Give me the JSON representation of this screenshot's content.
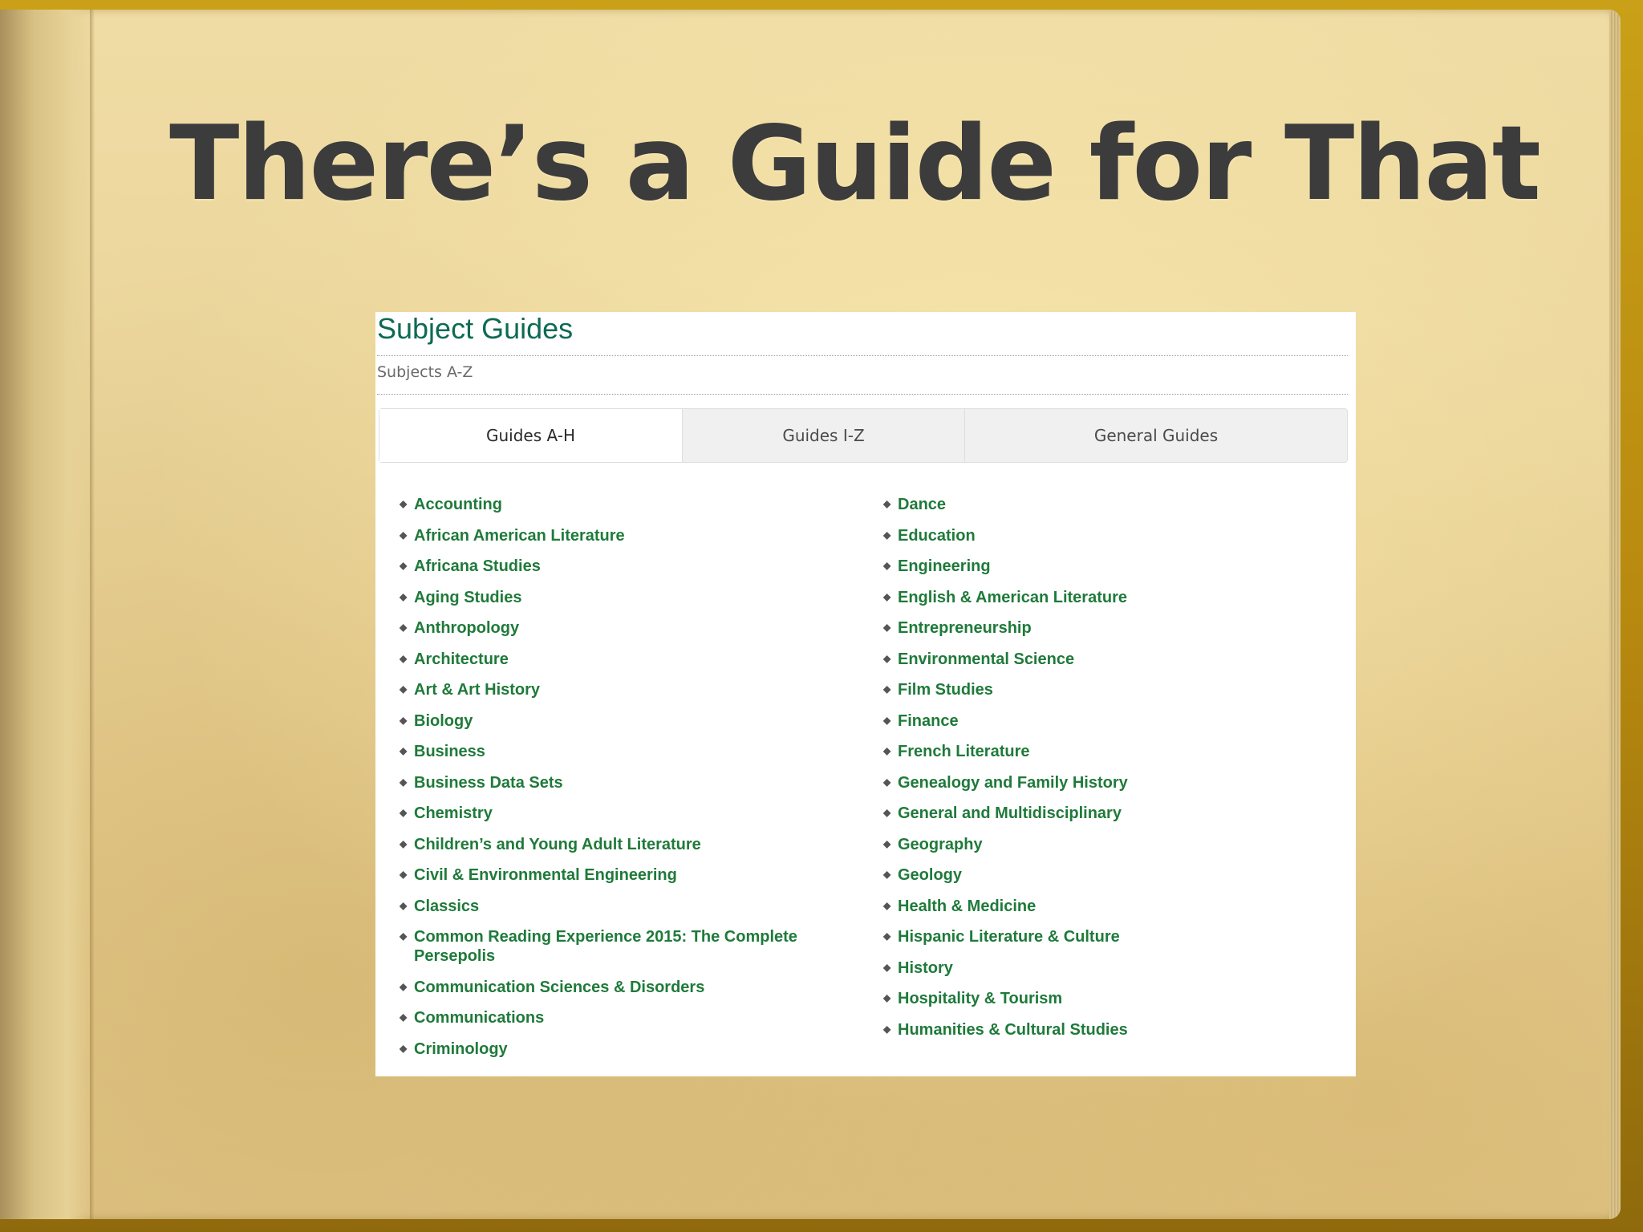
{
  "slide": {
    "title": "There’s a Guide for That"
  },
  "panel": {
    "heading": "Subject Guides",
    "breadcrumb": "Subjects A-Z",
    "tabs": [
      {
        "label": "Guides A-H",
        "active": true
      },
      {
        "label": "Guides I-Z",
        "active": false
      },
      {
        "label": "General Guides",
        "active": false
      }
    ],
    "left_column": [
      "Accounting",
      "African American Literature",
      "Africana Studies",
      "Aging Studies",
      "Anthropology",
      "Architecture",
      "Art & Art History",
      "Biology",
      "Business",
      "Business Data Sets",
      "Chemistry",
      "Children’s and Young Adult Literature",
      "Civil & Environmental Engineering",
      "Classics",
      "Common Reading Experience 2015: The Complete Persepolis",
      "Communication Sciences & Disorders",
      "Communications",
      "Criminology"
    ],
    "right_column": [
      "Dance",
      "Education",
      "Engineering",
      "English & American Literature",
      "Entrepreneurship",
      "Environmental Science",
      "Film Studies",
      "Finance",
      "French Literature",
      "Genealogy and Family History",
      "General and Multidisciplinary",
      "Geography",
      "Geology",
      "Health & Medicine",
      "Hispanic Literature & Culture",
      "History",
      "Hospitality & Tourism",
      "Humanities & Cultural Studies"
    ],
    "bullet_glyph": "◆",
    "colors": {
      "heading": "#0e6a55",
      "link": "#1f7a3a"
    }
  }
}
